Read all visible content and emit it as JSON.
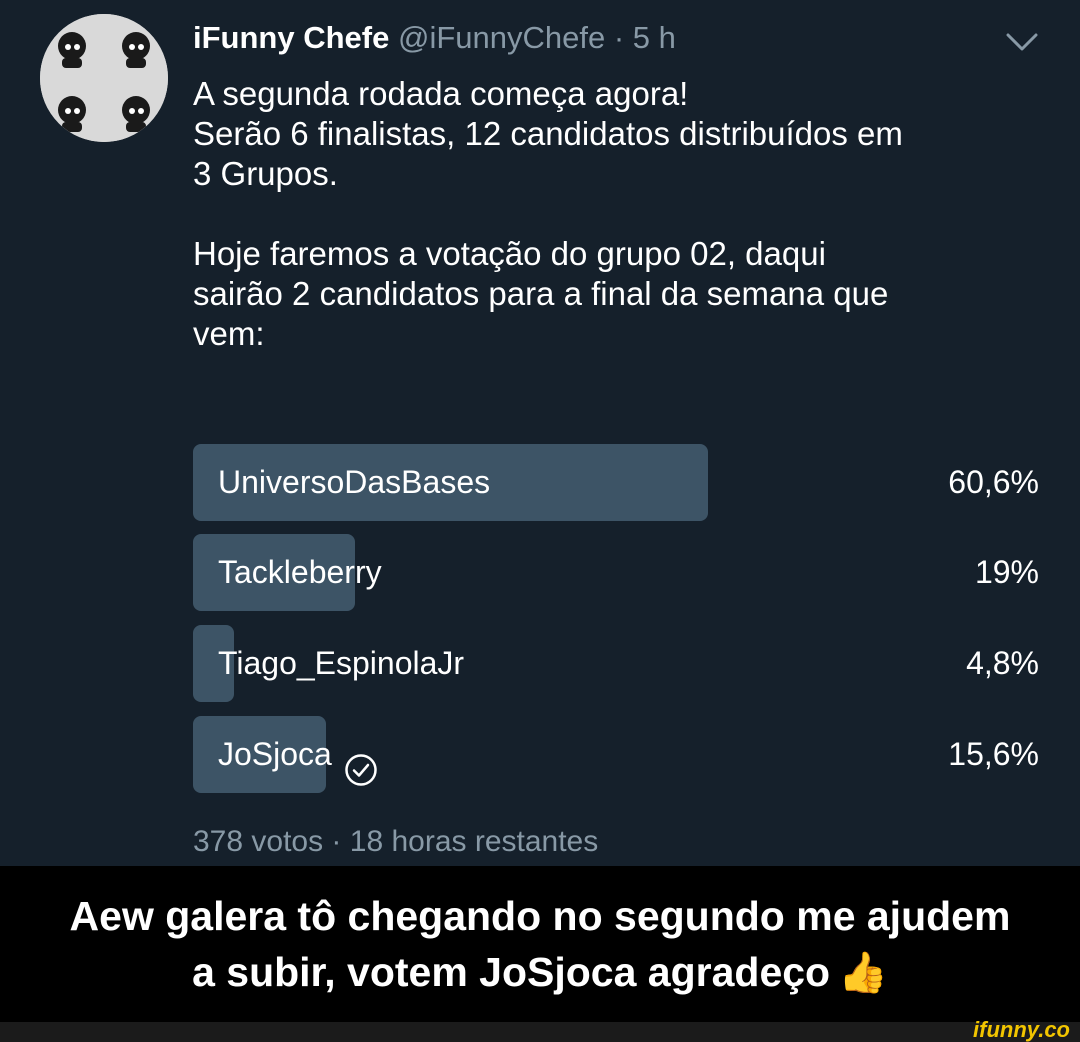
{
  "tweet": {
    "author_name": "iFunny Chefe",
    "author_handle": "@iFunnyChefe",
    "separator": " · ",
    "time": "5 h",
    "text": "A segunda rodada começa agora!\nSerão 6 finalistas, 12 candidatos distribuídos em\n3 Grupos.\n\nHoje faremos a votação do grupo 02, daqui\nsairão 2 candidatos para a final da semana que\nvem:"
  },
  "poll": {
    "options": [
      {
        "label": "UniversoDasBases",
        "percent_text": "60,6%",
        "fraction": 0.606,
        "check": false
      },
      {
        "label": "Tackleberry",
        "percent_text": "19%",
        "fraction": 0.19,
        "check": false
      },
      {
        "label": "Tiago_EspinolaJr",
        "percent_text": "4,8%",
        "fraction": 0.048,
        "check": false
      },
      {
        "label": "JoSjoca",
        "percent_text": "15,6%",
        "fraction": 0.156,
        "check": true
      }
    ],
    "footer": "378 votos · 18 horas restantes"
  },
  "caption": {
    "line1": "Aew galera tô chegando no segundo me ajudem",
    "line2": "a subir, votem JoSjoca agradeço",
    "emoji": "👍"
  },
  "watermark": "ifunny.co",
  "colors": {
    "background": "#15202b",
    "bar": "#3d5466",
    "muted": "#8899a6",
    "watermark": "#f2c500"
  },
  "icons": [
    "avatar",
    "chevron-down-icon",
    "check-circle-icon",
    "thumbs-up-icon"
  ]
}
